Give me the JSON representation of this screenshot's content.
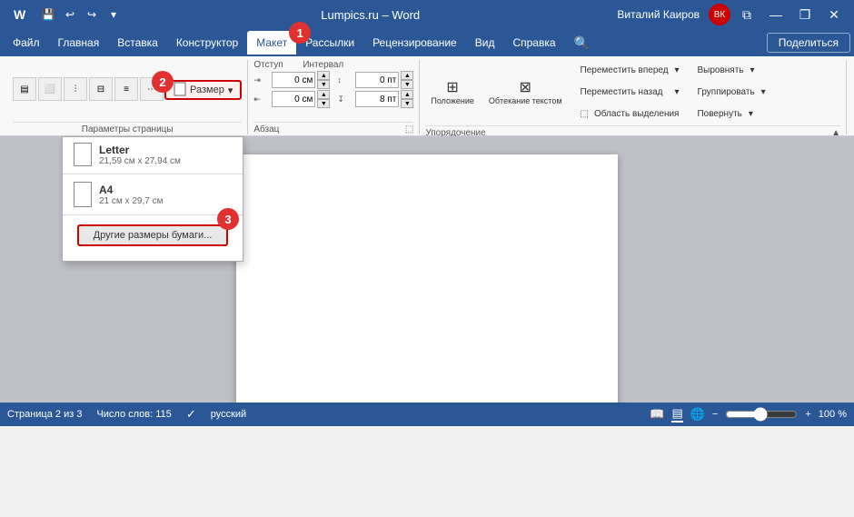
{
  "titlebar": {
    "title": "Lumpics.ru – Word",
    "user": "Виталий Каиров",
    "save_label": "💾",
    "undo_label": "↩",
    "redo_label": "↪",
    "dropdown_label": "▾",
    "minimize_label": "—",
    "maximize_label": "❐",
    "close_label": "✕",
    "restore_label": "⧉"
  },
  "menu": {
    "items": [
      {
        "id": "file",
        "label": "Файл"
      },
      {
        "id": "home",
        "label": "Главная"
      },
      {
        "id": "insert",
        "label": "Вставка"
      },
      {
        "id": "constructor",
        "label": "Конструктор"
      },
      {
        "id": "layout",
        "label": "Макет"
      },
      {
        "id": "references",
        "label": "Рассылки"
      },
      {
        "id": "review",
        "label": "Рецензирование"
      },
      {
        "id": "view",
        "label": "Вид"
      },
      {
        "id": "help",
        "label": "Справка"
      },
      {
        "id": "search",
        "label": "🔍"
      }
    ],
    "share_label": "Поделиться",
    "active": "layout"
  },
  "ribbon": {
    "size_btn_label": "Размер",
    "otherSizes_label": "Другие размеры бумаги...",
    "sections": {
      "paragraph_label": "Абзац",
      "arrange_label": "Упорядочение"
    },
    "indent": {
      "left_label": "Отступ",
      "right_label": "Интервал",
      "left_value": "0 см",
      "right_value": "0 пт",
      "bottom_value": "8 пт"
    },
    "arrange_btns": [
      "Переместить вперед",
      "Переместить назад",
      "Область выделения",
      "Положение",
      "Обтекание текстом"
    ]
  },
  "dropdown": {
    "items": [
      {
        "name": "Letter",
        "size": "21,59 см х 27,94 см"
      },
      {
        "name": "A4",
        "size": "21 см х 29,7 см"
      }
    ],
    "other_btn": "Другие размеры бумаги..."
  },
  "statusbar": {
    "page_info": "Страница 2 из 3",
    "word_count": "Число слов: 115",
    "lang": "русский",
    "zoom_value": "100 %"
  },
  "badges": {
    "one": "1",
    "two": "2",
    "three": "3"
  }
}
